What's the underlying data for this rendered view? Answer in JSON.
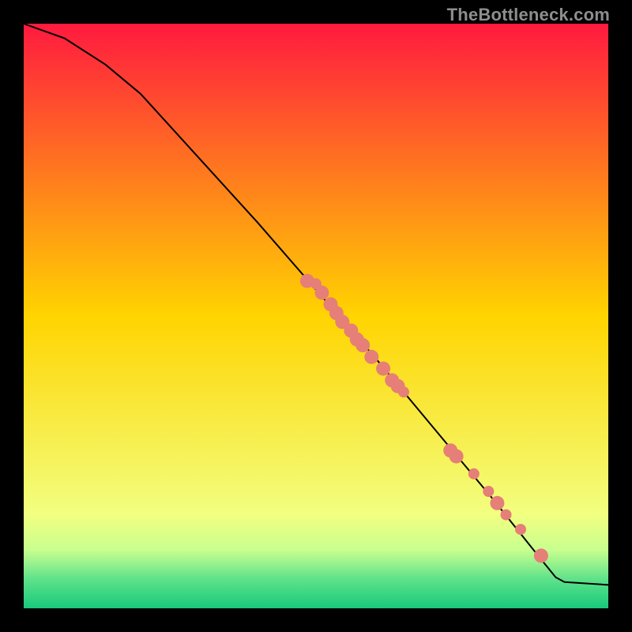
{
  "watermark": "TheBottleneck.com",
  "chart_data": {
    "type": "line",
    "title": "",
    "xlabel": "",
    "ylabel": "",
    "xlim": [
      0,
      100
    ],
    "ylim": [
      0,
      100
    ],
    "grid": false,
    "background_gradient_stops": [
      {
        "pos": 0.0,
        "color": "#ff1a3f"
      },
      {
        "pos": 0.5,
        "color": "#ffd400"
      },
      {
        "pos": 0.84,
        "color": "#f2ff80"
      },
      {
        "pos": 0.9,
        "color": "#c8ff8f"
      },
      {
        "pos": 0.95,
        "color": "#5fe28a"
      },
      {
        "pos": 1.0,
        "color": "#17c97b"
      }
    ],
    "line": {
      "color": "#000000",
      "width": 2,
      "points": [
        {
          "x": 0,
          "y": 100
        },
        {
          "x": 7,
          "y": 97.5
        },
        {
          "x": 14,
          "y": 93
        },
        {
          "x": 20,
          "y": 88
        },
        {
          "x": 30,
          "y": 77
        },
        {
          "x": 40,
          "y": 66
        },
        {
          "x": 50,
          "y": 54.5
        },
        {
          "x": 60,
          "y": 43
        },
        {
          "x": 70,
          "y": 31
        },
        {
          "x": 80,
          "y": 19
        },
        {
          "x": 88,
          "y": 9
        },
        {
          "x": 91,
          "y": 5.3
        },
        {
          "x": 92.5,
          "y": 4.5
        },
        {
          "x": 100,
          "y": 4.0
        }
      ]
    },
    "markers": {
      "color": "#e57f77",
      "radius_small": 7,
      "radius_big": 9,
      "points": [
        {
          "x": 48.5,
          "y": 56,
          "r": "big"
        },
        {
          "x": 50,
          "y": 55.5,
          "r": "small"
        },
        {
          "x": 51,
          "y": 54,
          "r": "big"
        },
        {
          "x": 52.5,
          "y": 52,
          "r": "big"
        },
        {
          "x": 53.5,
          "y": 50.5,
          "r": "big"
        },
        {
          "x": 54.5,
          "y": 49,
          "r": "big"
        },
        {
          "x": 56,
          "y": 47.5,
          "r": "big"
        },
        {
          "x": 57,
          "y": 46,
          "r": "big"
        },
        {
          "x": 58,
          "y": 45,
          "r": "big"
        },
        {
          "x": 59.5,
          "y": 43,
          "r": "big"
        },
        {
          "x": 61.5,
          "y": 41,
          "r": "big"
        },
        {
          "x": 63,
          "y": 39,
          "r": "big"
        },
        {
          "x": 64,
          "y": 38,
          "r": "big"
        },
        {
          "x": 65,
          "y": 37,
          "r": "small"
        },
        {
          "x": 73,
          "y": 27,
          "r": "big"
        },
        {
          "x": 74,
          "y": 26,
          "r": "big"
        },
        {
          "x": 77,
          "y": 23,
          "r": "small"
        },
        {
          "x": 79.5,
          "y": 20,
          "r": "small"
        },
        {
          "x": 81,
          "y": 18,
          "r": "big"
        },
        {
          "x": 82.5,
          "y": 16,
          "r": "small"
        },
        {
          "x": 85,
          "y": 13.5,
          "r": "small"
        },
        {
          "x": 88.5,
          "y": 9,
          "r": "big"
        }
      ]
    }
  }
}
